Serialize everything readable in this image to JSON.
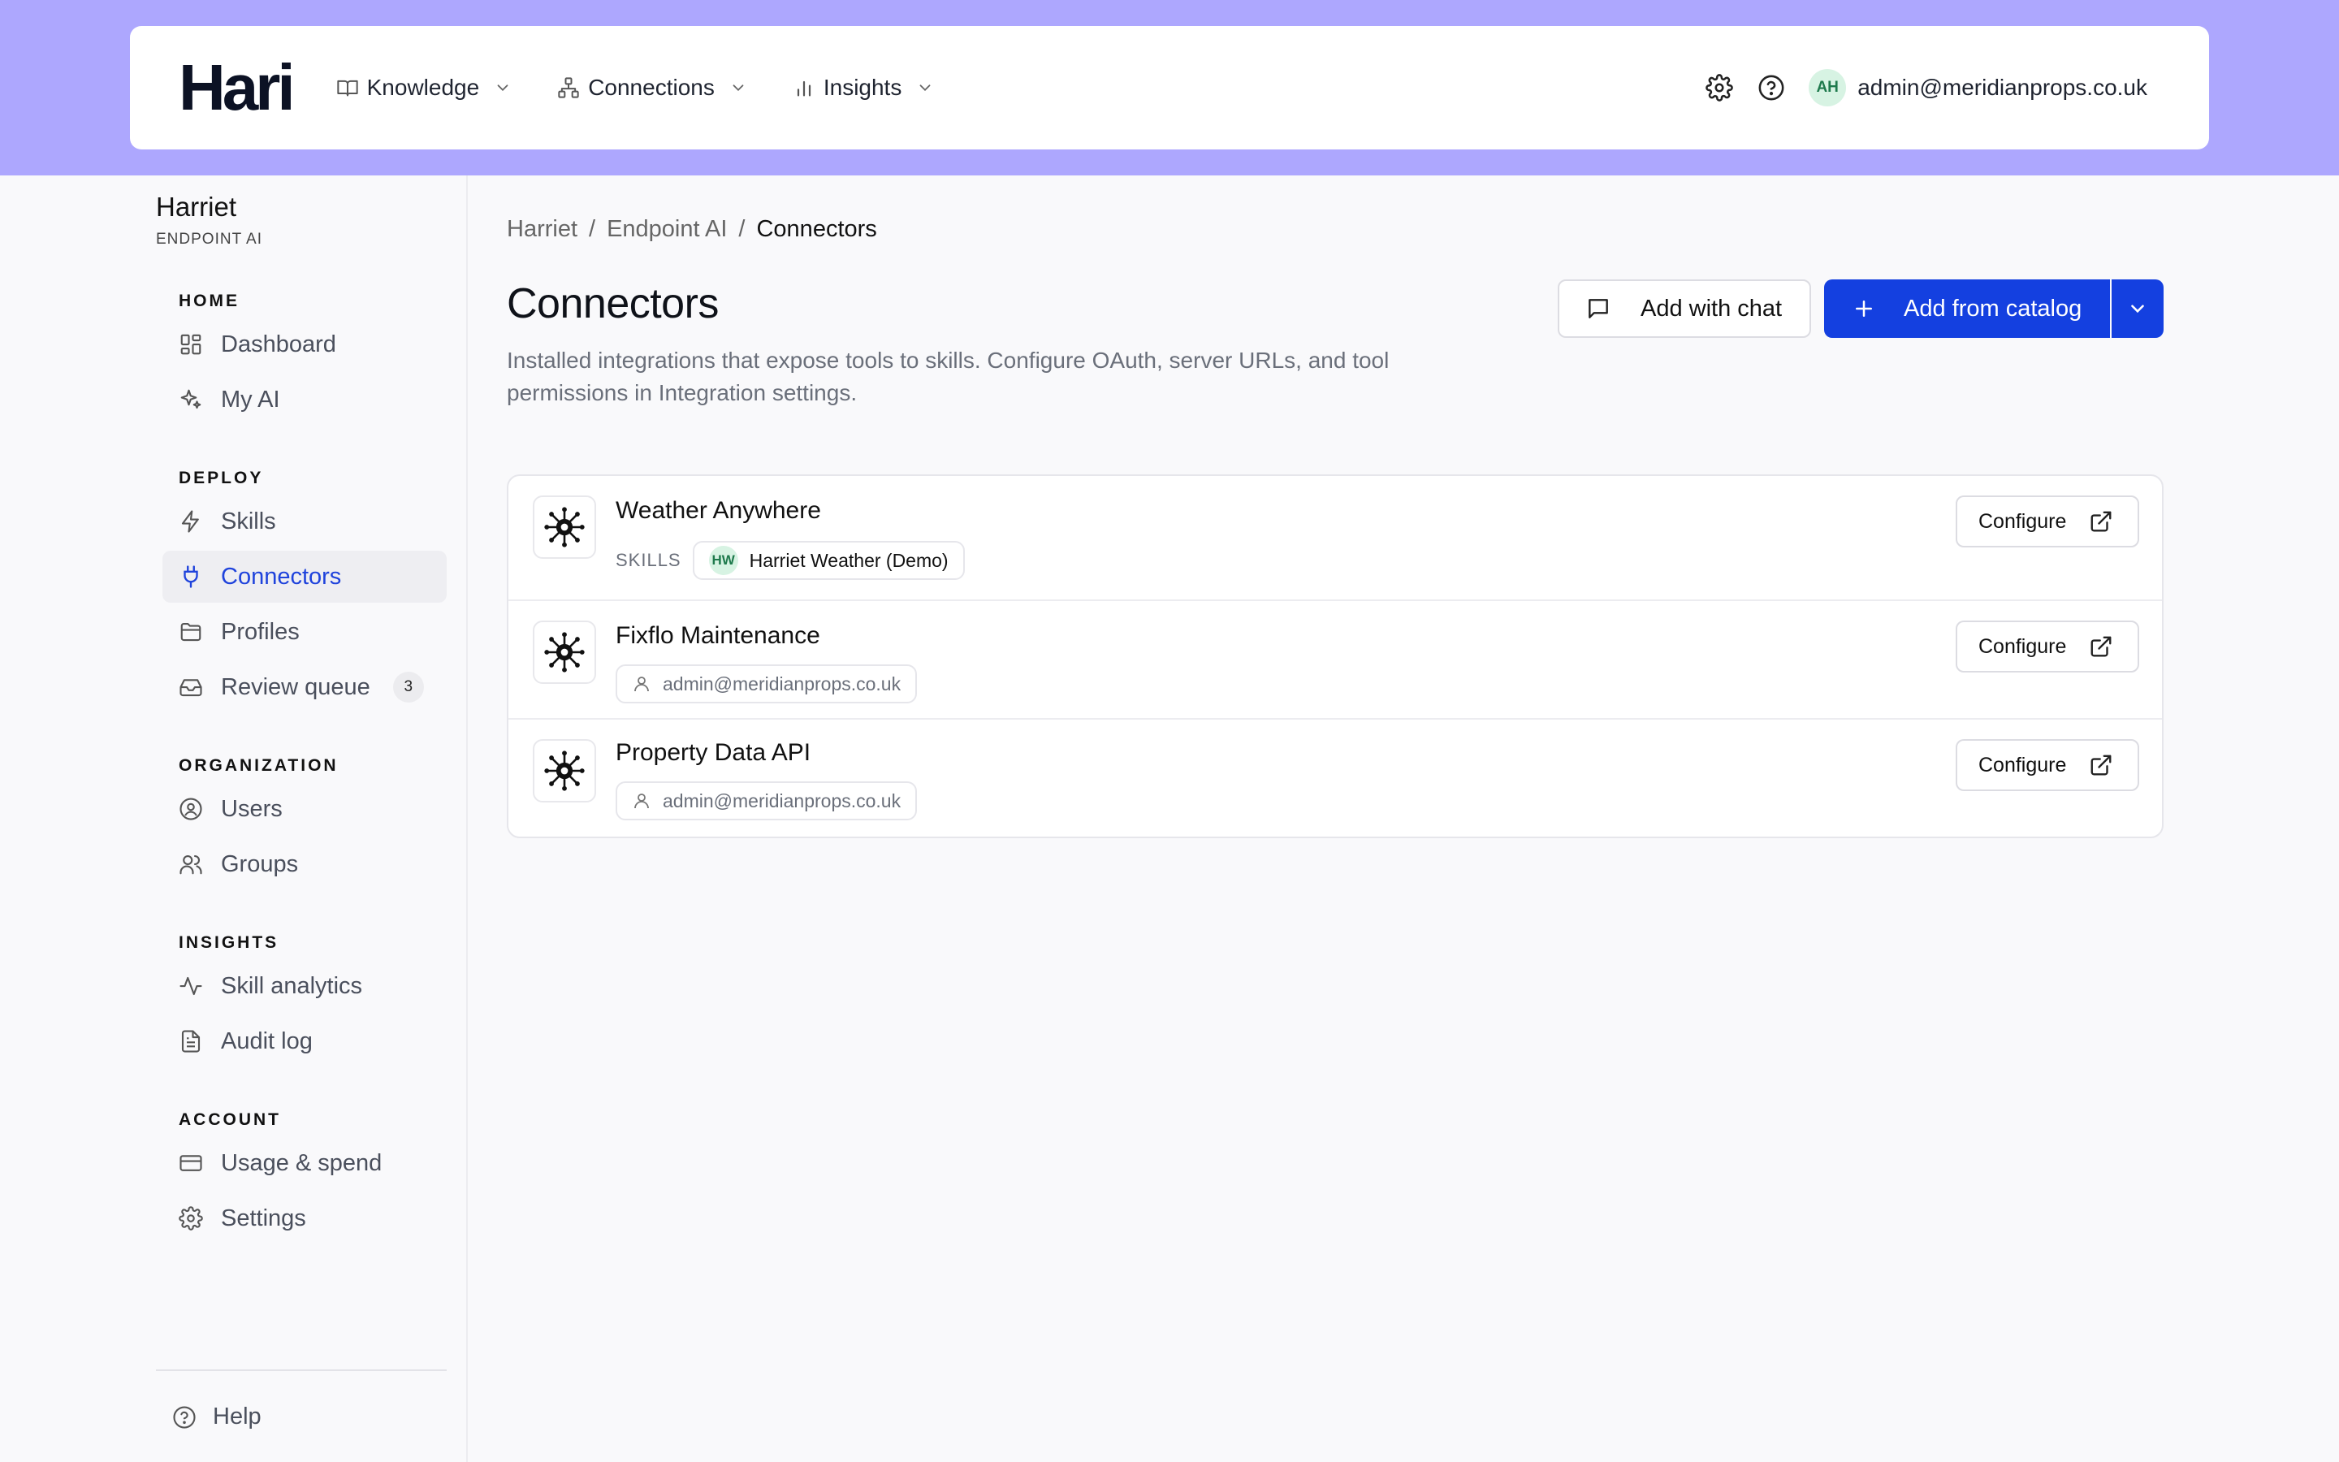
{
  "header": {
    "logo": "Hari",
    "nav": [
      {
        "label": "Knowledge",
        "icon": "book-icon"
      },
      {
        "label": "Connections",
        "icon": "network-icon"
      },
      {
        "label": "Insights",
        "icon": "bar-chart-icon"
      }
    ],
    "user": {
      "initials": "AH",
      "email": "admin@meridianprops.co.uk"
    }
  },
  "sidebar": {
    "workspace": "Harriet",
    "workspace_sub": "ENDPOINT AI",
    "sections": [
      {
        "heading": "HOME",
        "items": [
          {
            "label": "Dashboard",
            "icon": "dashboard-icon"
          },
          {
            "label": "My AI",
            "icon": "sparkles-icon"
          }
        ]
      },
      {
        "heading": "DEPLOY",
        "items": [
          {
            "label": "Skills",
            "icon": "lightning-icon"
          },
          {
            "label": "Connectors",
            "icon": "plug-icon",
            "active": true
          },
          {
            "label": "Profiles",
            "icon": "folder-icon"
          },
          {
            "label": "Review queue",
            "icon": "inbox-icon",
            "count": "3"
          }
        ]
      },
      {
        "heading": "ORGANIZATION",
        "items": [
          {
            "label": "Users",
            "icon": "user-circle-icon"
          },
          {
            "label": "Groups",
            "icon": "users-icon"
          }
        ]
      },
      {
        "heading": "INSIGHTS",
        "items": [
          {
            "label": "Skill analytics",
            "icon": "activity-icon"
          },
          {
            "label": "Audit log",
            "icon": "file-text-icon"
          }
        ]
      },
      {
        "heading": "ACCOUNT",
        "items": [
          {
            "label": "Usage & spend",
            "icon": "credit-card-icon"
          },
          {
            "label": "Settings",
            "icon": "gear-icon"
          }
        ]
      }
    ],
    "help": "Help"
  },
  "main": {
    "breadcrumb": [
      "Harriet",
      "Endpoint AI",
      "Connectors"
    ],
    "title": "Connectors",
    "description": "Installed integrations that expose tools to skills. Configure OAuth, server URLs, and tool permissions in Integration settings.",
    "add_with_chat": "Add with chat",
    "add_from_catalog": "Add from catalog",
    "skills_label": "SKILLS",
    "configure_label": "Configure",
    "connectors": [
      {
        "name": "Weather Anywhere",
        "skill": {
          "initials": "HW",
          "name": "Harriet Weather (Demo)"
        }
      },
      {
        "name": "Fixflo Maintenance",
        "owner": "admin@meridianprops.co.uk"
      },
      {
        "name": "Property Data API",
        "owner": "admin@meridianprops.co.uk"
      }
    ]
  },
  "colors": {
    "accent": "#1440e0",
    "band": "#ada7fe",
    "active_text": "#1f43dc"
  }
}
